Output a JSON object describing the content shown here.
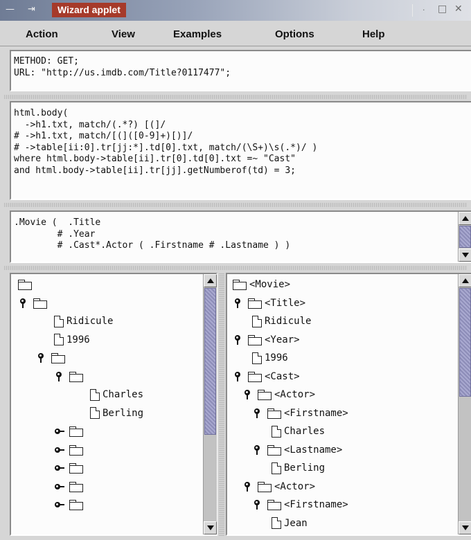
{
  "window": {
    "title": "Wizard applet",
    "icons": {
      "menu": "window-menu-icon",
      "pin": "pin-icon",
      "minimize": "minimize-icon",
      "maximize": "maximize-icon",
      "close": "close-icon"
    }
  },
  "menu": {
    "items": [
      {
        "label": "Action"
      },
      {
        "label": "View"
      },
      {
        "label": "Examples"
      },
      {
        "label": "Options"
      },
      {
        "label": "Help"
      }
    ]
  },
  "request": {
    "lines": [
      "METHOD: GET;",
      "URL: \"http://us.imdb.com/Title?0117477\";"
    ]
  },
  "rules": {
    "lines": [
      "html.body(",
      "  ->h1.txt, match/(.*?) [(]/",
      "# ->h1.txt, match/[(]([0-9]+)[)]/",
      "# ->table[ii:0].tr[jj:*].td[0].txt, match/(\\S+)\\s(.*)/ )",
      "where html.body->table[ii].tr[0].td[0].txt =~ \"Cast\"",
      "and html.body->table[ii].tr[jj].getNumberof(td) = 3;"
    ]
  },
  "schema": {
    "lines": [
      ".Movie (  .Title",
      "        # .Year",
      "        # .Cast*.Actor ( .Firstname # .Lastname ) )"
    ]
  },
  "left_tree": {
    "nodes": [
      {
        "indent": 0,
        "toggle": "none",
        "icon": "folder",
        "text": ""
      },
      {
        "indent": 0,
        "toggle": "expanded",
        "icon": "folder",
        "text": ""
      },
      {
        "indent": 2,
        "toggle": "none",
        "icon": "page",
        "text": "Ridicule"
      },
      {
        "indent": 2,
        "toggle": "none",
        "icon": "page",
        "text": "1996"
      },
      {
        "indent": 1,
        "toggle": "expanded",
        "icon": "folder",
        "text": ""
      },
      {
        "indent": 2,
        "toggle": "expanded",
        "icon": "folder",
        "text": ""
      },
      {
        "indent": 4,
        "toggle": "none",
        "icon": "page",
        "text": "Charles"
      },
      {
        "indent": 4,
        "toggle": "none",
        "icon": "page",
        "text": "Berling"
      },
      {
        "indent": 2,
        "toggle": "collapsed",
        "icon": "folder",
        "text": ""
      },
      {
        "indent": 2,
        "toggle": "collapsed",
        "icon": "folder",
        "text": ""
      },
      {
        "indent": 2,
        "toggle": "collapsed",
        "icon": "folder",
        "text": ""
      },
      {
        "indent": 2,
        "toggle": "collapsed",
        "icon": "folder",
        "text": ""
      },
      {
        "indent": 2,
        "toggle": "collapsed",
        "icon": "folder",
        "text": ""
      }
    ]
  },
  "right_tree": {
    "nodes": [
      {
        "indent": 0,
        "toggle": "none",
        "icon": "folder",
        "text": "<Movie>"
      },
      {
        "indent": 0,
        "toggle": "expanded",
        "icon": "folder",
        "text": "<Title>"
      },
      {
        "indent": 2,
        "toggle": "none",
        "icon": "page",
        "text": "Ridicule"
      },
      {
        "indent": 0,
        "toggle": "expanded",
        "icon": "folder",
        "text": "<Year>"
      },
      {
        "indent": 2,
        "toggle": "none",
        "icon": "page",
        "text": "1996"
      },
      {
        "indent": 0,
        "toggle": "expanded",
        "icon": "folder",
        "text": "<Cast>"
      },
      {
        "indent": 1,
        "toggle": "expanded",
        "icon": "folder",
        "text": "<Actor>"
      },
      {
        "indent": 2,
        "toggle": "expanded",
        "icon": "folder",
        "text": "<Firstname>"
      },
      {
        "indent": 4,
        "toggle": "none",
        "icon": "page",
        "text": "Charles"
      },
      {
        "indent": 2,
        "toggle": "expanded",
        "icon": "folder",
        "text": "<Lastname>"
      },
      {
        "indent": 4,
        "toggle": "none",
        "icon": "page",
        "text": "Berling"
      },
      {
        "indent": 1,
        "toggle": "expanded",
        "icon": "folder",
        "text": "<Actor>"
      },
      {
        "indent": 2,
        "toggle": "expanded",
        "icon": "folder",
        "text": "<Firstname>"
      },
      {
        "indent": 4,
        "toggle": "none",
        "icon": "page",
        "text": "Jean"
      }
    ]
  }
}
